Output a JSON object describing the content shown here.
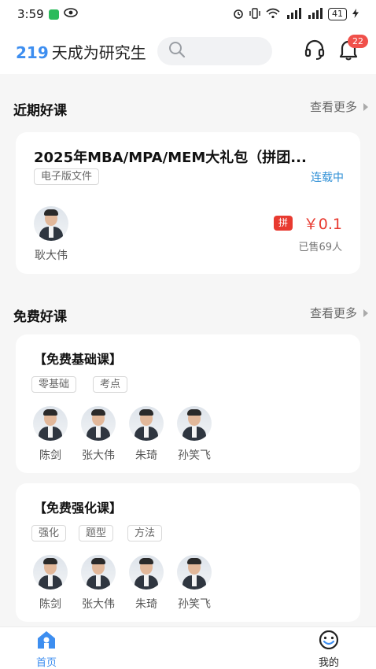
{
  "status_bar": {
    "time": "3:59",
    "battery": "41"
  },
  "header": {
    "brand_number": "219",
    "brand_text": "天成为研究生",
    "notification_count": "22"
  },
  "recent_section": {
    "title": "近期好课",
    "more": "查看更多",
    "course": {
      "title": "2025年MBA/MPA/MEM大礼包（拼团...",
      "tag": "电子版文件",
      "status": "连载中",
      "teacher": "耿大伟",
      "group_badge": "拼",
      "price": "￥0.1",
      "sold": "已售69人"
    }
  },
  "free_section": {
    "title": "免费好课",
    "more": "查看更多",
    "courses": [
      {
        "title": "【免费基础课】",
        "tags": [
          "零基础",
          "考点"
        ],
        "teachers": [
          "陈剑",
          "张大伟",
          "朱琦",
          "孙笑飞"
        ]
      },
      {
        "title": "【免费强化课】",
        "tags": [
          "强化",
          "题型",
          "方法"
        ],
        "teachers": [
          "陈剑",
          "张大伟",
          "朱琦",
          "孙笑飞"
        ]
      }
    ]
  },
  "tabbar": {
    "home": "首页",
    "mine": "我的",
    "active_color": "#3d8ef0"
  },
  "colors": {
    "accent": "#3d8ef0",
    "price": "#e83a30",
    "serial": "#2e8fd6"
  }
}
